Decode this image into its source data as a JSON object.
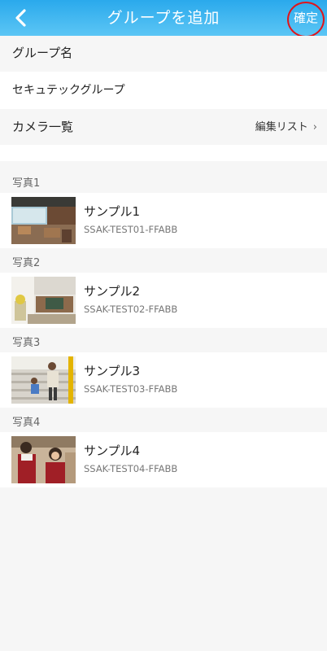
{
  "header": {
    "title": "グループを追加",
    "confirm_label": "確定",
    "gradient_top": "#2aa9ec",
    "gradient_bottom": "#5cc6f5",
    "highlight_color": "#e0141b"
  },
  "form": {
    "group_name_label": "グループ名",
    "group_name_value": "セキュテックグループ",
    "camera_list_label": "カメラ一覧",
    "edit_list_label": "編集リスト"
  },
  "cameras": [
    {
      "section": "写真1",
      "name": "サンプル1",
      "id": "SSAK-TEST01-FFABB",
      "thumb": "cafe-interior-photo"
    },
    {
      "section": "写真2",
      "name": "サンプル2",
      "id": "SSAK-TEST02-FFABB",
      "thumb": "living-room-photo"
    },
    {
      "section": "写真3",
      "name": "サンプル3",
      "id": "SSAK-TEST03-FFABB",
      "thumb": "stairs-people-photo"
    },
    {
      "section": "写真4",
      "name": "サンプル4",
      "id": "SSAK-TEST04-FFABB",
      "thumb": "shop-staff-photo"
    }
  ]
}
